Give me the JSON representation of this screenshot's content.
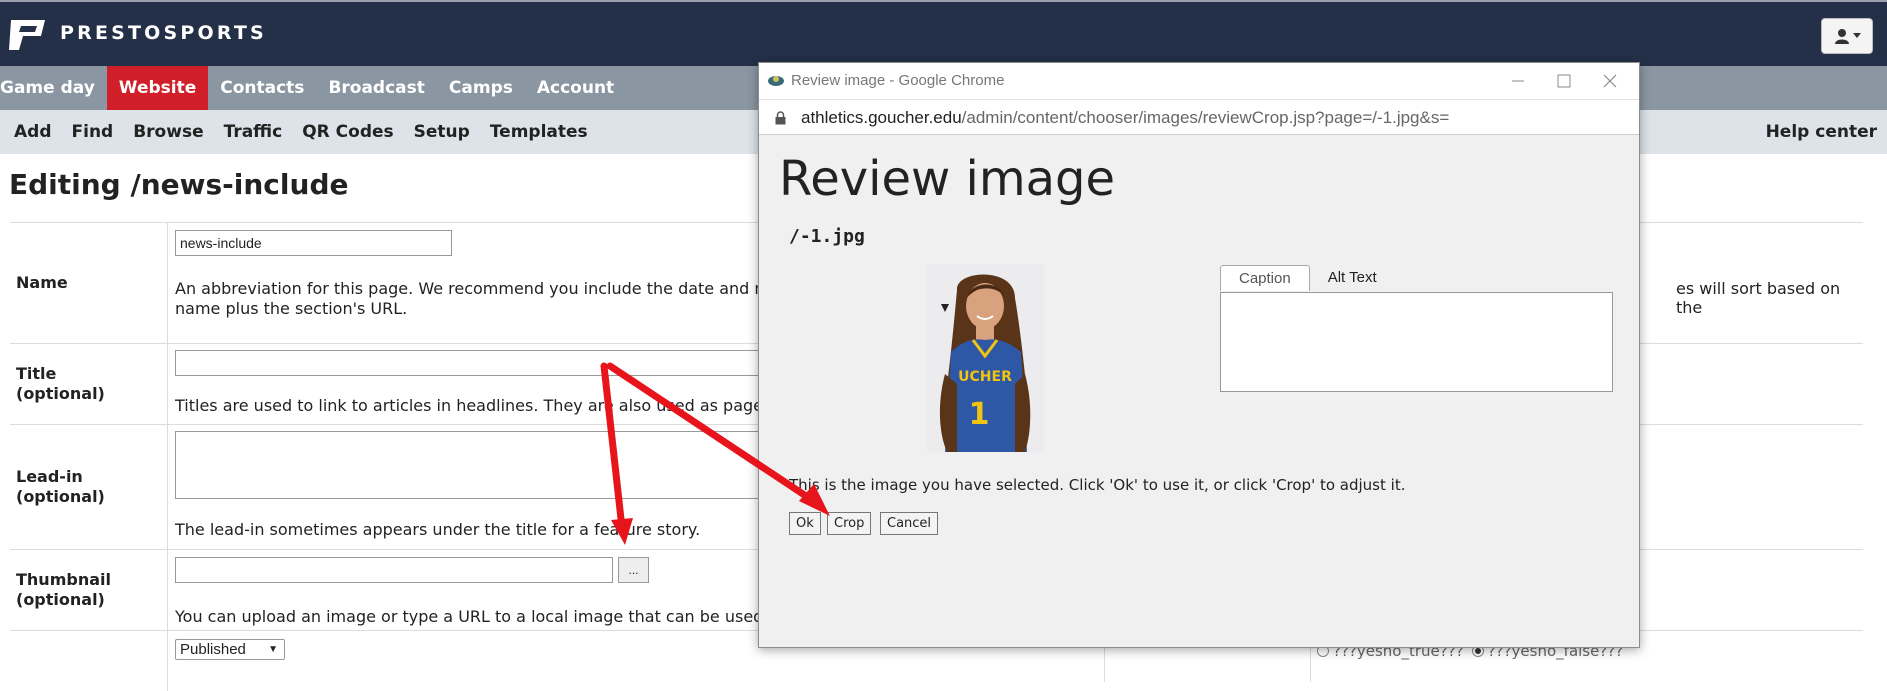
{
  "app": {
    "brand": "PRESTOSPORTS"
  },
  "main_nav": [
    "Game day",
    "Website",
    "Contacts",
    "Broadcast",
    "Camps",
    "Account"
  ],
  "sub_nav": [
    "Add",
    "Find",
    "Browse",
    "Traffic",
    "QR Codes",
    "Setup",
    "Templates"
  ],
  "help_center": "Help center",
  "page": {
    "title": "Editing /news-include"
  },
  "form": {
    "name": {
      "label": "Name",
      "value": "news-include",
      "help": "An abbreviation for this page. We recommend you include the date and majo",
      "help_right": "es will sort based on the",
      "help_line2": "name plus the section's URL."
    },
    "title": {
      "label1": "Title",
      "label2": "(optional)",
      "help": "Titles are used to link to articles in headlines. They are also used as page head"
    },
    "leadin": {
      "label1": "Lead-in",
      "label2": "(optional)",
      "help": "The lead-in sometimes appears under the title for a feature story."
    },
    "thumbnail": {
      "label1": "Thumbnail",
      "label2": "(optional)",
      "browse_label": "...",
      "help": "You can upload an image or type a URL to a local image that can be used as a"
    },
    "status": {
      "value": "Published",
      "radio_true": "???yesno_true???",
      "radio_false": "???yesno_false???"
    }
  },
  "popup": {
    "window_title": "Review image - Google Chrome",
    "url_host": "athletics.goucher.edu",
    "url_path": "/admin/content/chooser/images/reviewCrop.jsp?page=/-1.jpg&s=",
    "heading": "Review image",
    "filename": "/-1.jpg",
    "tabs": [
      "Caption",
      "Alt Text"
    ],
    "caption_value": "",
    "message": "This is the image you have selected. Click 'Ok' to use it, or click 'Crop' to adjust it.",
    "buttons": {
      "ok": "Ok",
      "crop": "Crop",
      "cancel": "Cancel"
    },
    "jersey_text": "UCHER",
    "jersey_number": "1"
  },
  "colors": {
    "topbar": "#233048",
    "main_nav": "#8a96a2",
    "active_nav": "#d01f28",
    "sub_nav": "#dde3e9",
    "annotation_arrow": "#e8141b"
  },
  "icons": [
    "logo-icon",
    "user-icon",
    "caret-down-icon",
    "minimize-icon",
    "maximize-icon",
    "close-icon",
    "lock-icon",
    "chrome-app-icon",
    "arrow-annotation"
  ]
}
